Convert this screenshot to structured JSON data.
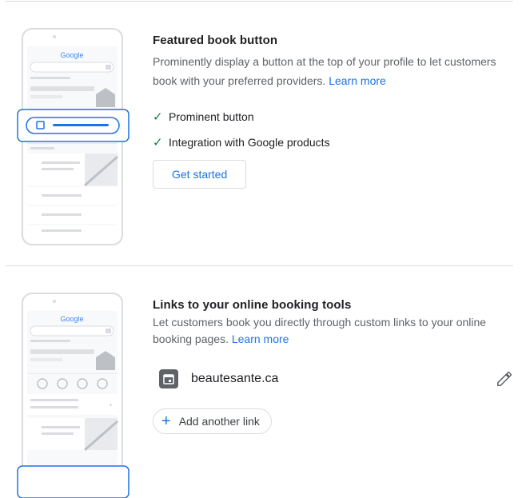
{
  "featured": {
    "title": "Featured book button",
    "description": "Prominently display a button at the top of your profile to let customers book with your preferred providers.",
    "learn_more": "Learn more",
    "features": [
      "Prominent button",
      "Integration with Google products"
    ],
    "cta": "Get started",
    "illustration_logo": "Google"
  },
  "links": {
    "title": "Links to your online booking tools",
    "description": "Let customers book you directly through custom links to your online booking pages.",
    "learn_more": "Learn more",
    "items": [
      {
        "url": "beautesante.ca",
        "icon": "calendar-icon",
        "action_icon": "pencil-icon"
      }
    ],
    "add_link": "Add another link",
    "illustration_logo": "Google"
  },
  "colors": {
    "accent": "#1a73e8",
    "check": "#188038",
    "divider": "#dadce0"
  }
}
